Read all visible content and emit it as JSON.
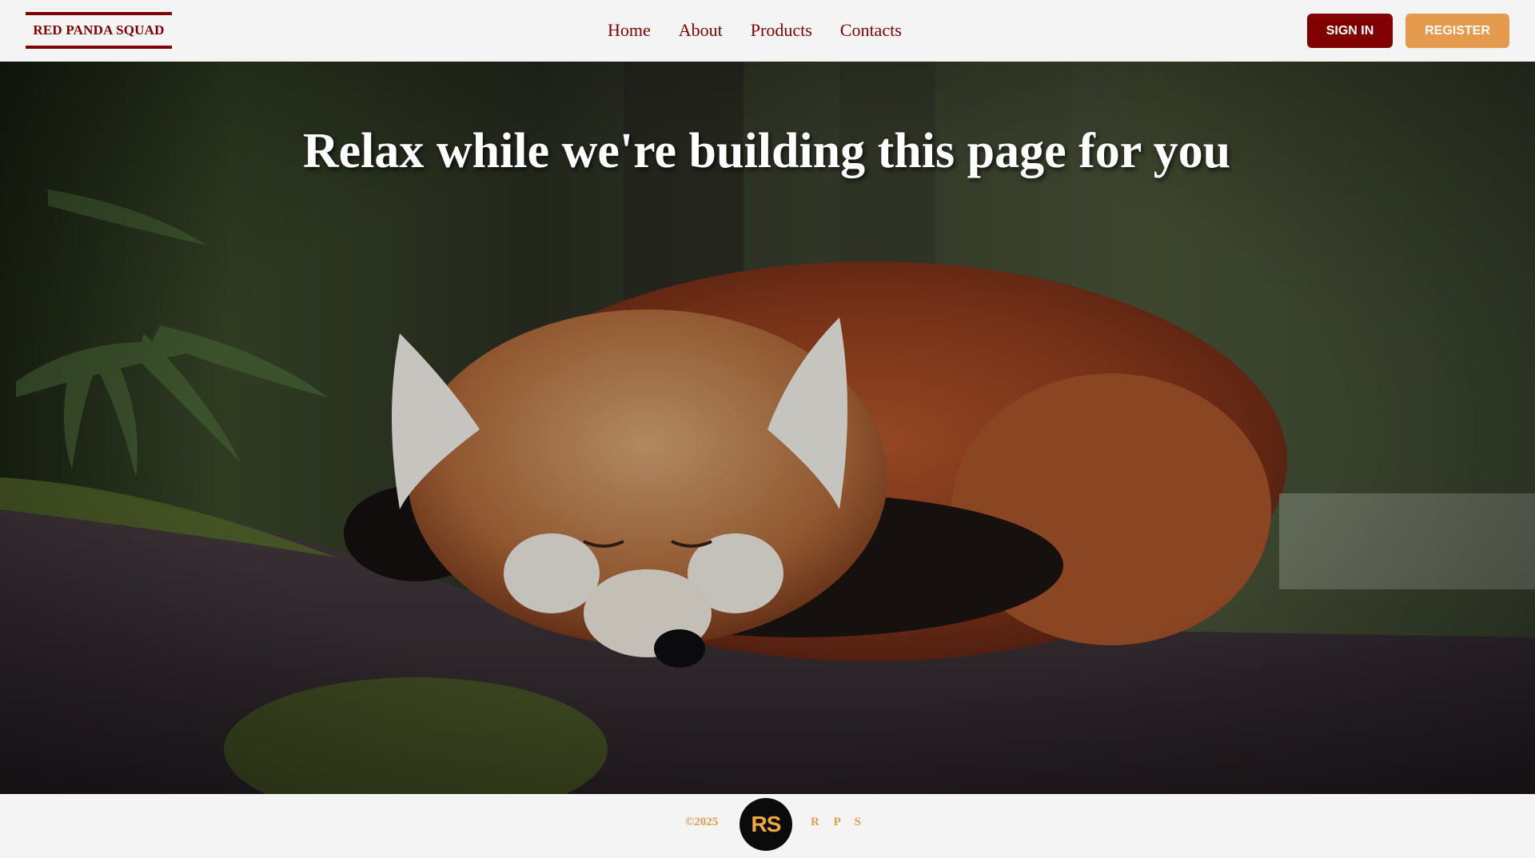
{
  "header": {
    "logo_text": "RED PANDA SQUAD",
    "nav": [
      {
        "label": "Home"
      },
      {
        "label": "About"
      },
      {
        "label": "Products"
      },
      {
        "label": "Contacts"
      }
    ],
    "sign_in_label": "SIGN IN",
    "register_label": "REGISTER"
  },
  "hero": {
    "title": "Relax while we're building this page for you",
    "image_subject": "sleeping red panda on a mossy log in a bamboo forest"
  },
  "footer": {
    "copyright": "©2025",
    "badge_text": "RS",
    "initials": "R P S"
  },
  "colors": {
    "brand": "#800000",
    "accent": "#e59b4e",
    "background": "#f4f4f4",
    "badge_bg": "#0b0b0b",
    "badge_text": "#f0a93a"
  }
}
